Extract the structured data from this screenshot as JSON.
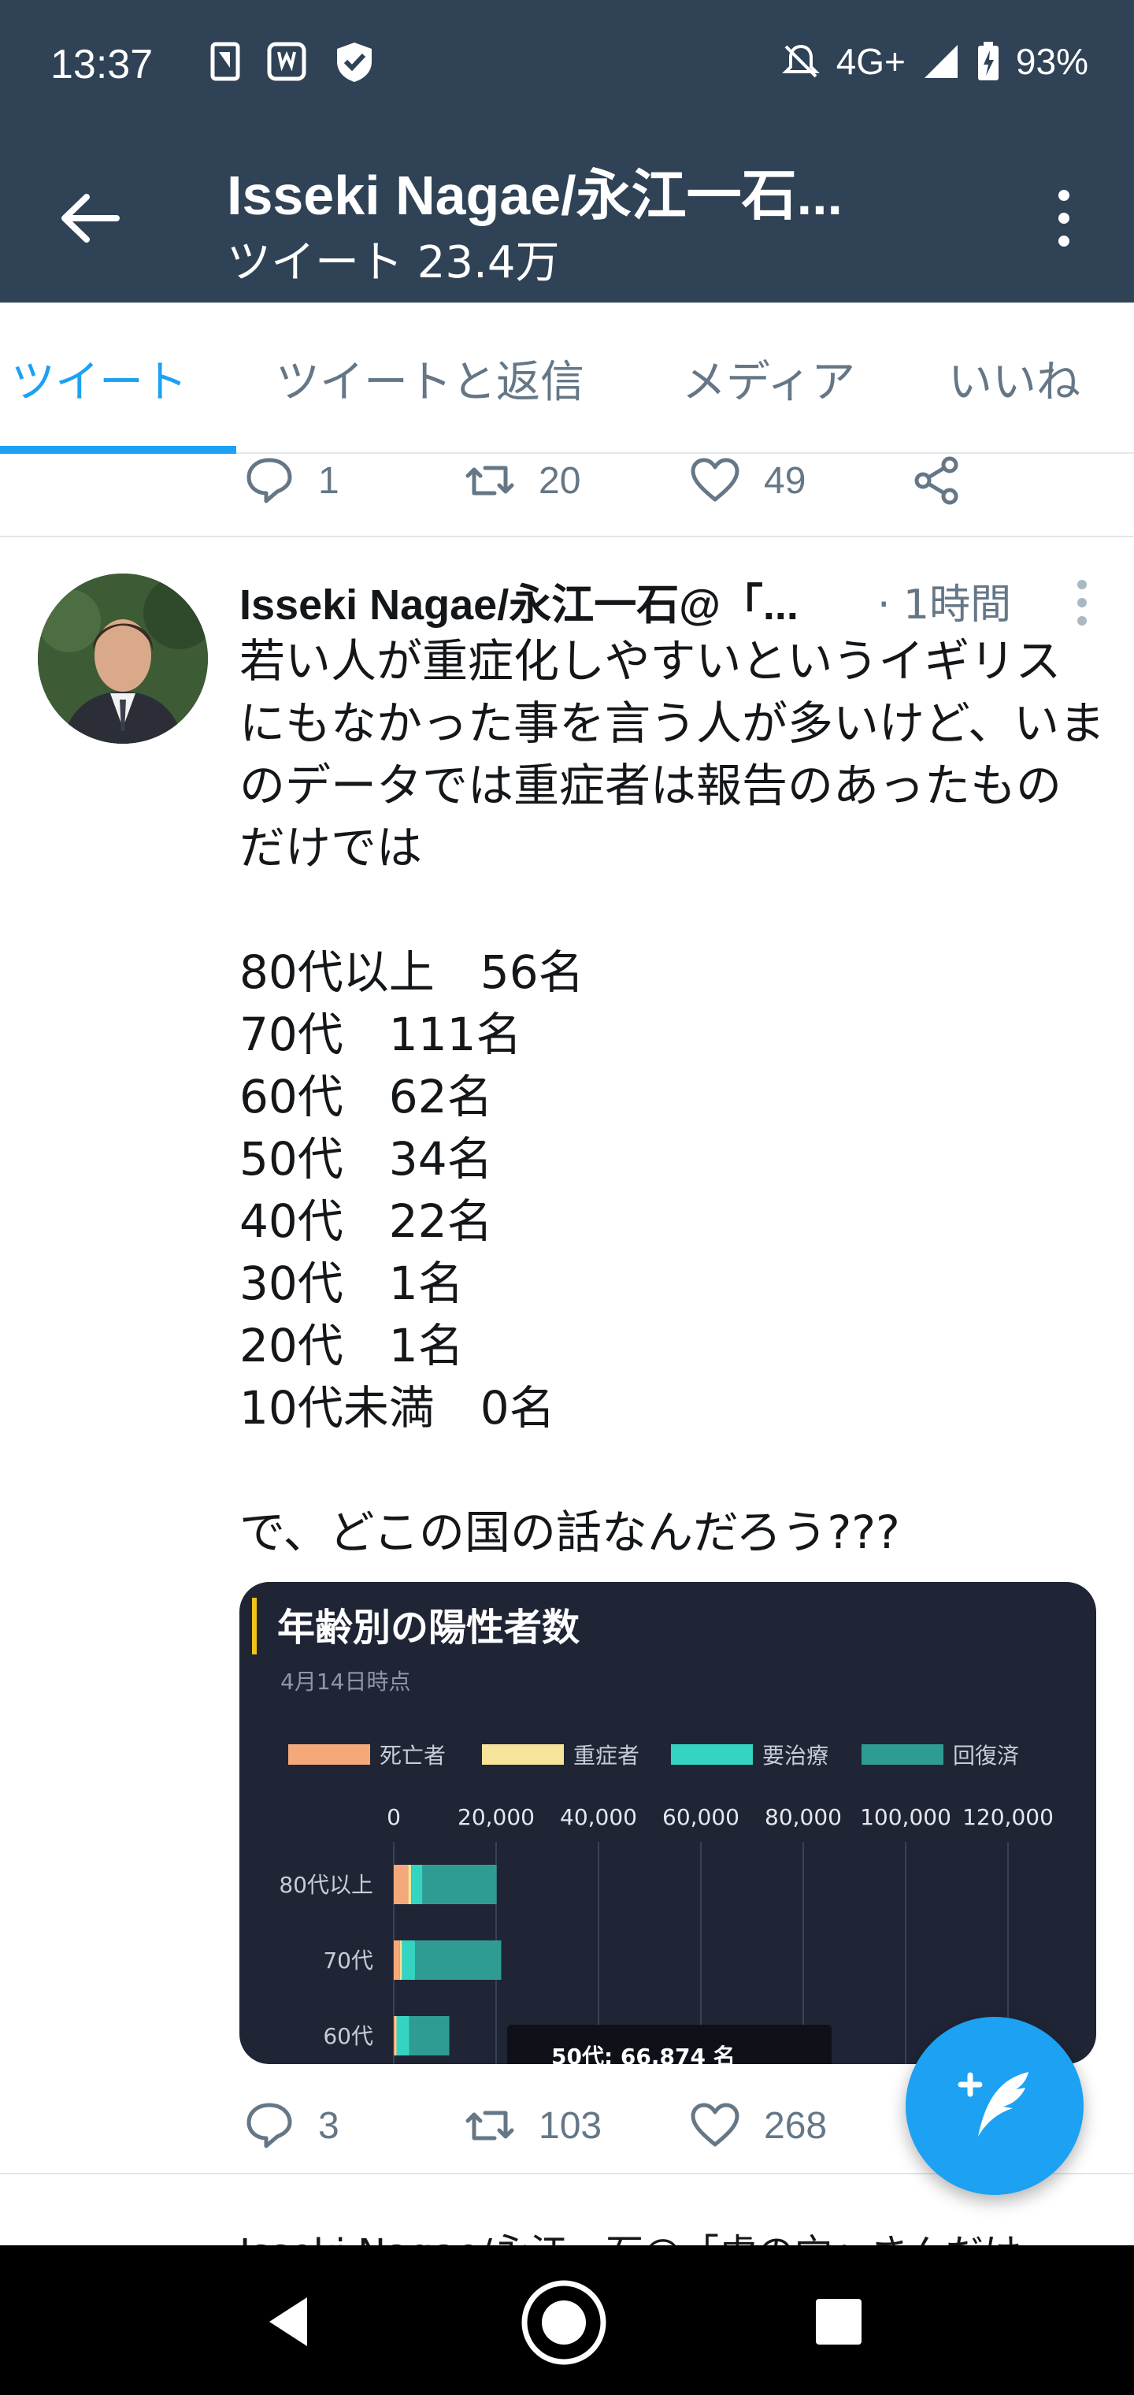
{
  "status_bar": {
    "time": "13:37",
    "network": "4G+",
    "battery": "93%",
    "icons": [
      "sim-card-icon",
      "tag-icon",
      "shield-icon",
      "mute-icon",
      "signal-icon",
      "battery-charging-icon"
    ]
  },
  "header": {
    "title": "Isseki Nagae/永江一石...",
    "subtitle": "ツイート 23.4万"
  },
  "tabs": [
    {
      "label": "ツイート",
      "active": true
    },
    {
      "label": "ツイートと返信",
      "active": false
    },
    {
      "label": "メディア",
      "active": false
    },
    {
      "label": "いいね",
      "active": false
    }
  ],
  "prev_tweet": {
    "replies": "1",
    "retweets": "20",
    "likes": "49"
  },
  "tweet": {
    "author": "Isseki Nagae/永江一石@「...",
    "time": "· 1時間",
    "body": "若い人が重症化しやすいというイギリスにもなかった事を言う人が多いけど、いまのデータでは重症者は報告のあったものだけでは\n\n80代以上　56名\n70代　111名\n60代　62名\n50代　34名\n40代　22名\n30代　1名\n20代　1名\n10代未満　0名\n\nで、どこの国の話なんだろう???",
    "replies": "3",
    "retweets": "103",
    "likes": "268"
  },
  "embedded_chart": {
    "title": "年齢別の陽性者数",
    "subtitle": "4月14日時点",
    "tooltip": "50代: 66,874 名",
    "colors": {
      "death": "#f5a97a",
      "severe": "#f8e39b",
      "treatment": "#35d3c2",
      "recovered": "#2f9c94"
    }
  },
  "chart_data": {
    "type": "bar",
    "orientation": "horizontal",
    "stacked": true,
    "title": "年齢別の陽性者数",
    "subtitle": "4月14日時点",
    "x_ticks": [
      "0",
      "20,000",
      "40,000",
      "60,000",
      "80,000",
      "100,000",
      "120,000"
    ],
    "xlim": [
      0,
      120000
    ],
    "categories": [
      "80代以上",
      "70代",
      "60代"
    ],
    "series": [
      {
        "name": "死亡者",
        "values": [
          2800,
          1200,
          300
        ]
      },
      {
        "name": "重症者",
        "values": [
          600,
          400,
          250
        ]
      },
      {
        "name": "要治療",
        "values": [
          2200,
          2600,
          2500
        ]
      },
      {
        "name": "回復済",
        "values": [
          14500,
          16800,
          7800
        ]
      }
    ],
    "legend_position": "top"
  },
  "next_tweet_peek": "Isseki Nagae/永江一石@「虎の穴」さんだけ",
  "fab": {
    "icon": "compose-tweet-icon"
  }
}
